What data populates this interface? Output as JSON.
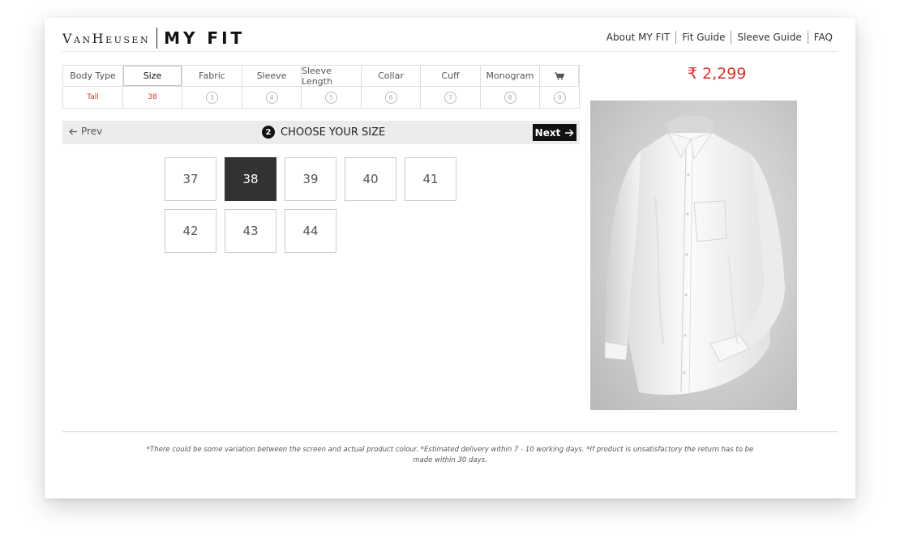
{
  "brand": {
    "name": "VanHeusen",
    "product": "MY FIT"
  },
  "topnav": [
    {
      "label": "About MY FIT"
    },
    {
      "label": "Fit Guide"
    },
    {
      "label": "Sleeve Guide"
    },
    {
      "label": "FAQ"
    }
  ],
  "steps": [
    {
      "label": "Body Type",
      "value": "Tall",
      "num": ""
    },
    {
      "label": "Size",
      "value": "38",
      "num": ""
    },
    {
      "label": "Fabric",
      "value": "",
      "num": "3"
    },
    {
      "label": "Sleeve",
      "value": "",
      "num": "4"
    },
    {
      "label": "Sleeve Length",
      "value": "",
      "num": "5"
    },
    {
      "label": "Collar",
      "value": "",
      "num": "6"
    },
    {
      "label": "Cuff",
      "value": "",
      "num": "7"
    },
    {
      "label": "Monogram",
      "value": "",
      "num": "8"
    },
    {
      "label": "",
      "icon": "cart-icon",
      "value": "",
      "num": "9"
    }
  ],
  "active_step": "Size",
  "chooser": {
    "prev_label": "Prev",
    "step_number": "2",
    "title": "CHOOSE YOUR SIZE",
    "next_label": "Next"
  },
  "sizes": [
    "37",
    "38",
    "39",
    "40",
    "41",
    "42",
    "43",
    "44"
  ],
  "selected_size": "38",
  "price": {
    "currency_symbol": "₹",
    "amount": "2,299"
  },
  "footer_note": "*There could be some variation between the screen and actual product colour.  *Estimated delivery within 7 - 10 working days.  *If product is unsatisfactory the return has to be made within 30 days.",
  "colors": {
    "accent": "#d0362a",
    "selected": "#333333",
    "next_bg": "#111111"
  }
}
